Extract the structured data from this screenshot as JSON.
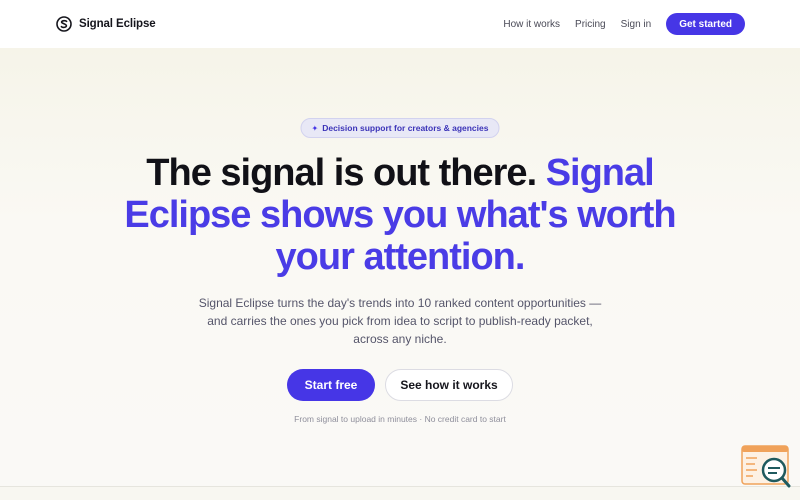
{
  "header": {
    "brand_name": "Signal Eclipse",
    "logo_icon": "s-swirl-icon",
    "nav_links": [
      "How it works",
      "Pricing",
      "Sign in"
    ],
    "cta_label": "Get started"
  },
  "hero": {
    "badge_icon": "sparkle-icon",
    "badge_text": "Decision support for creators & agencies",
    "headline_plain": "The signal is out there. ",
    "headline_accent": "Signal Eclipse shows you what's worth your attention.",
    "subheading": "Signal Eclipse turns the day's trends into 10 ranked content opportunities — and carries the ones you pick from idea to script to publish-ready packet, across any niche.",
    "primary_button": "Start free",
    "secondary_button": "See how it works",
    "fineprint": "From signal to upload in minutes · No credit card to start"
  },
  "widget": {
    "icon": "document-search-icon"
  },
  "colors": {
    "accent": "#4636e6",
    "accent_text": "#4a3ce6",
    "background": "#f8f7f1",
    "header_bg": "#ffffff",
    "text": "#15151c",
    "muted_text": "#55556a",
    "widget_orange": "#f0a25a",
    "widget_teal": "#1f5a5e"
  }
}
